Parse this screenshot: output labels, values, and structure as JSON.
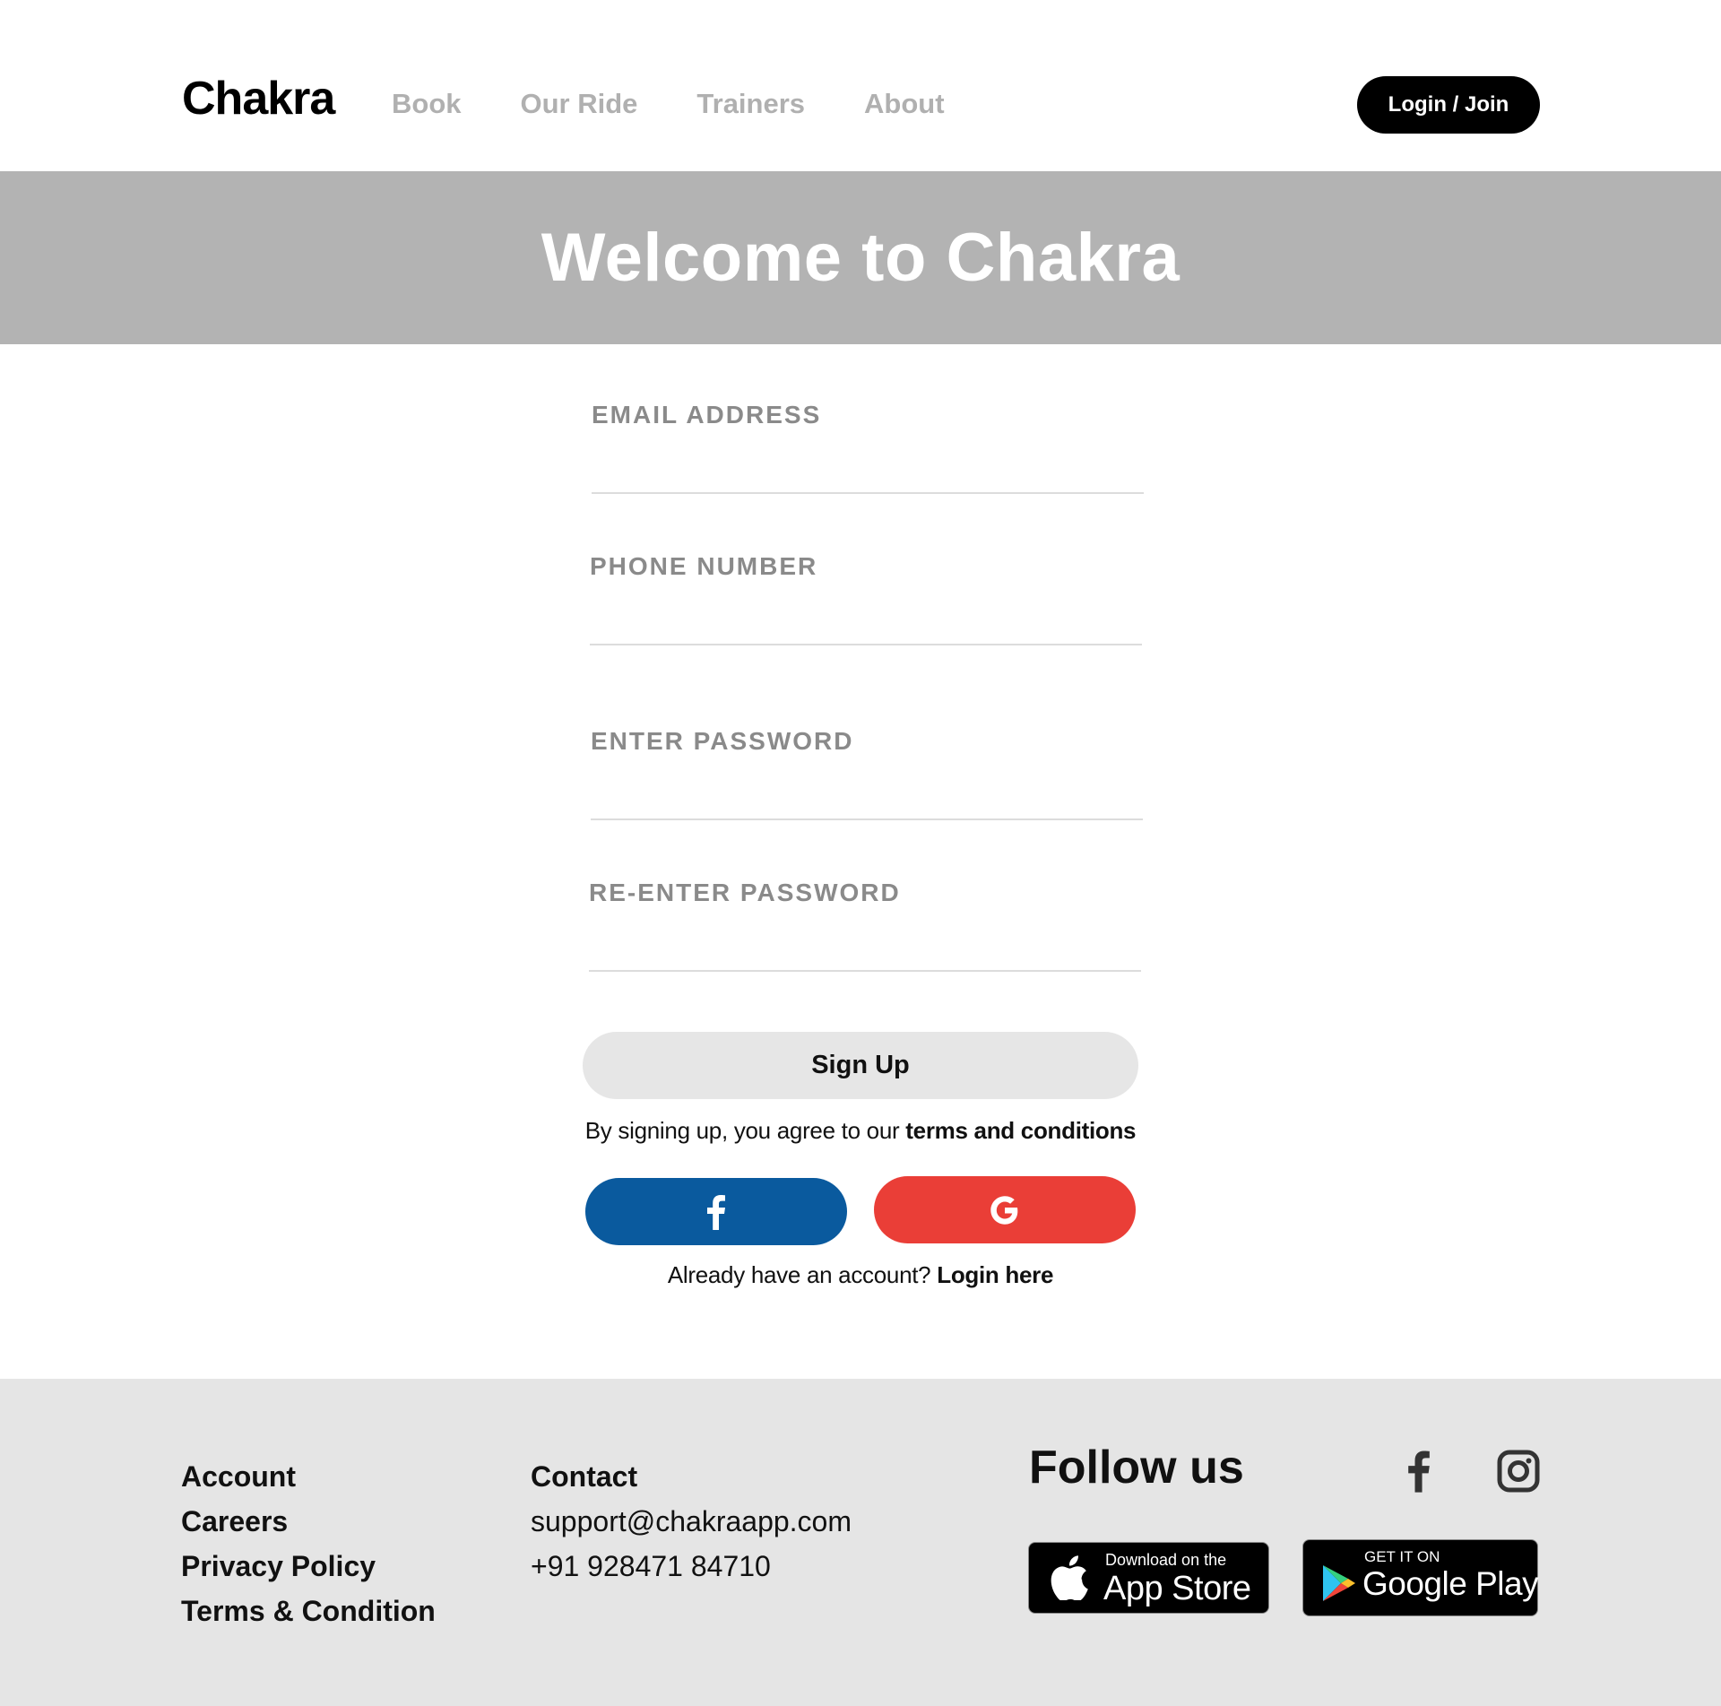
{
  "header": {
    "logo": "Chakra",
    "nav": [
      {
        "label": "Book"
      },
      {
        "label": "Our Ride"
      },
      {
        "label": "Trainers"
      },
      {
        "label": "About"
      }
    ],
    "login_label": "Login / Join"
  },
  "hero": {
    "title": "Welcome to Chakra"
  },
  "form": {
    "fields": [
      {
        "label": "EMAIL ADDRESS",
        "value": ""
      },
      {
        "label": "PHONE NUMBER",
        "value": ""
      },
      {
        "label": "ENTER PASSWORD",
        "value": ""
      },
      {
        "label": "RE-ENTER PASSWORD",
        "value": ""
      }
    ],
    "signup_label": "Sign Up",
    "terms_prefix": "By signing up, you agree to our ",
    "terms_link": "terms and conditions",
    "already_prefix": "Already have an account? ",
    "login_link": "Login here"
  },
  "social_buttons": {
    "facebook_icon": "facebook-icon",
    "google_icon": "google-icon",
    "facebook_color": "#0a5a9e",
    "google_color": "#ea3e37"
  },
  "footer": {
    "links": [
      "Account",
      "Careers",
      "Privacy Policy",
      "Terms & Condition"
    ],
    "contact_title": "Contact",
    "contact_email": "support@chakraapp.com",
    "contact_phone": "+91 928471 84710",
    "follow_title": "Follow us",
    "app_store": {
      "small": "Download on the",
      "big": "App Store"
    },
    "google_play": {
      "small": "GET IT ON",
      "big": "Google Play"
    }
  }
}
